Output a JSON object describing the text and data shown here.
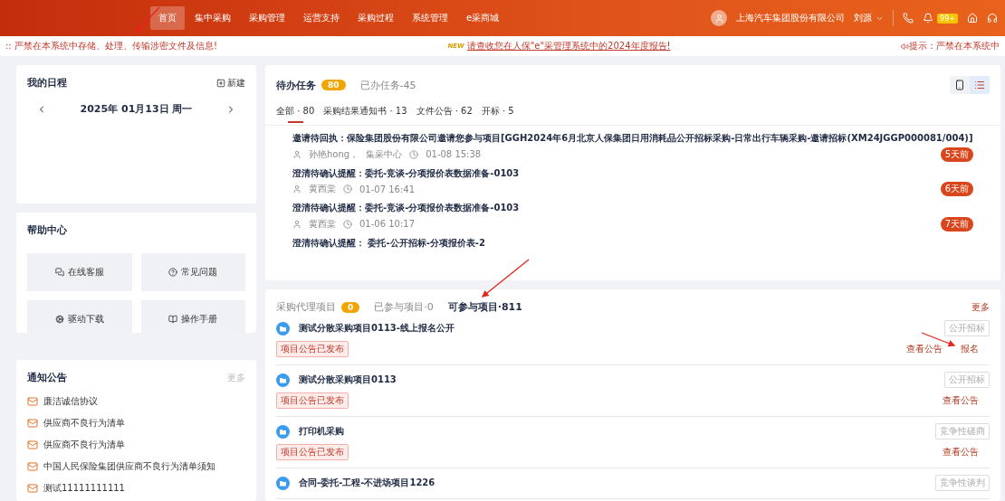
{
  "nav": {
    "items": [
      {
        "label": "首页",
        "selected": true
      },
      {
        "label": "集中采购",
        "selected": false
      },
      {
        "label": "采购管理",
        "selected": false
      },
      {
        "label": "运营支持",
        "selected": false
      },
      {
        "label": "采购过程",
        "selected": false
      },
      {
        "label": "系统管理",
        "selected": false
      },
      {
        "label": "e采商城",
        "selected": false
      }
    ],
    "company": "上海汽车集团股份有限公司",
    "user": "刘源",
    "badge": "99+"
  },
  "notice": {
    "left": ":: 严禁在本系统中存储、处理、传输涉密文件及信息!",
    "badge": "NEW",
    "center": "请查收您在人保\"e\"采管理系统中的2024年度报告!",
    "right": "提示：严禁在本系统中"
  },
  "schedule": {
    "title": "我的日程",
    "new_label": "新建",
    "date": "2025年 01月13日 周一"
  },
  "help": {
    "title": "帮助中心",
    "items": [
      {
        "label": "在线客服",
        "kind": "chat"
      },
      {
        "label": "常见问题",
        "kind": "question"
      },
      {
        "label": "驱动下载",
        "kind": "gears"
      },
      {
        "label": "操作手册",
        "kind": "book"
      }
    ]
  },
  "notices": {
    "title": "通知公告",
    "more": "更多",
    "items": [
      "廉洁诚信协议",
      "供应商不良行为清单",
      "供应商不良行为清单",
      "中国人民保险集团供应商不良行为清单须知",
      "测试11111111111"
    ]
  },
  "tasks": {
    "tabs": [
      {
        "label": "待办任务",
        "badge": "80",
        "selected": true
      },
      {
        "label": "已办任务-45",
        "selected": false
      }
    ],
    "views": [
      {
        "kind": "card",
        "selected": false
      },
      {
        "kind": "list",
        "selected": true
      }
    ],
    "subtabs": [
      {
        "label": "全部 · 80",
        "selected": true
      },
      {
        "label": "采购结果通知书 · 13",
        "selected": false
      },
      {
        "label": "文件公告 · 62",
        "selected": false
      },
      {
        "label": "开标 · 5",
        "selected": false
      }
    ],
    "items": [
      {
        "title": "邀请待回执：保险集团股份有限公司邀请您参与项目[GGH2024年6月北京人保集团日用消耗品公开招标采购-日常出行车辆采购-邀请招标(XM24JGGP000081/004)]",
        "author": "孙艳hong，",
        "dept": "集采中心",
        "time": "01-08 15:38",
        "ago": "5天前"
      },
      {
        "title": "澄清待确认提醒：委托-竞谈-分项报价表数据准备-0103",
        "author": "黄西棠",
        "time": "01-07 16:41",
        "ago": "6天前"
      },
      {
        "title": "澄清待确认提醒：委托-竞谈-分项报价表数据准备-0103",
        "author": "黄西棠",
        "time": "01-06 10:17",
        "ago": "7天前"
      },
      {
        "title": "澄清待确认提醒： 委托-公开招标-分项报价表-2"
      }
    ]
  },
  "projects": {
    "tabs": [
      {
        "label": "采购代理项目",
        "badge": "0",
        "selected": false
      },
      {
        "label": "已参与项目·0",
        "selected": false
      },
      {
        "label": "可参与项目·811",
        "selected": true
      }
    ],
    "more": "更多",
    "items": [
      {
        "title": "测试分散采购项目0113-线上报名公开",
        "type": "公开招标",
        "status": "项目公告已发布",
        "actions": [
          "查看公告",
          "报名"
        ]
      },
      {
        "title": "测试分散采购项目0113",
        "type": "公开招标",
        "status": "项目公告已发布",
        "actions": [
          "查看公告"
        ]
      },
      {
        "title": "打印机采购",
        "type": "竞争性磋商",
        "status": "项目公告已发布",
        "actions": [
          "查看公告"
        ]
      },
      {
        "title": "合同-委托-工程-不进场项目1226",
        "type": "竞争性谈判"
      }
    ]
  }
}
